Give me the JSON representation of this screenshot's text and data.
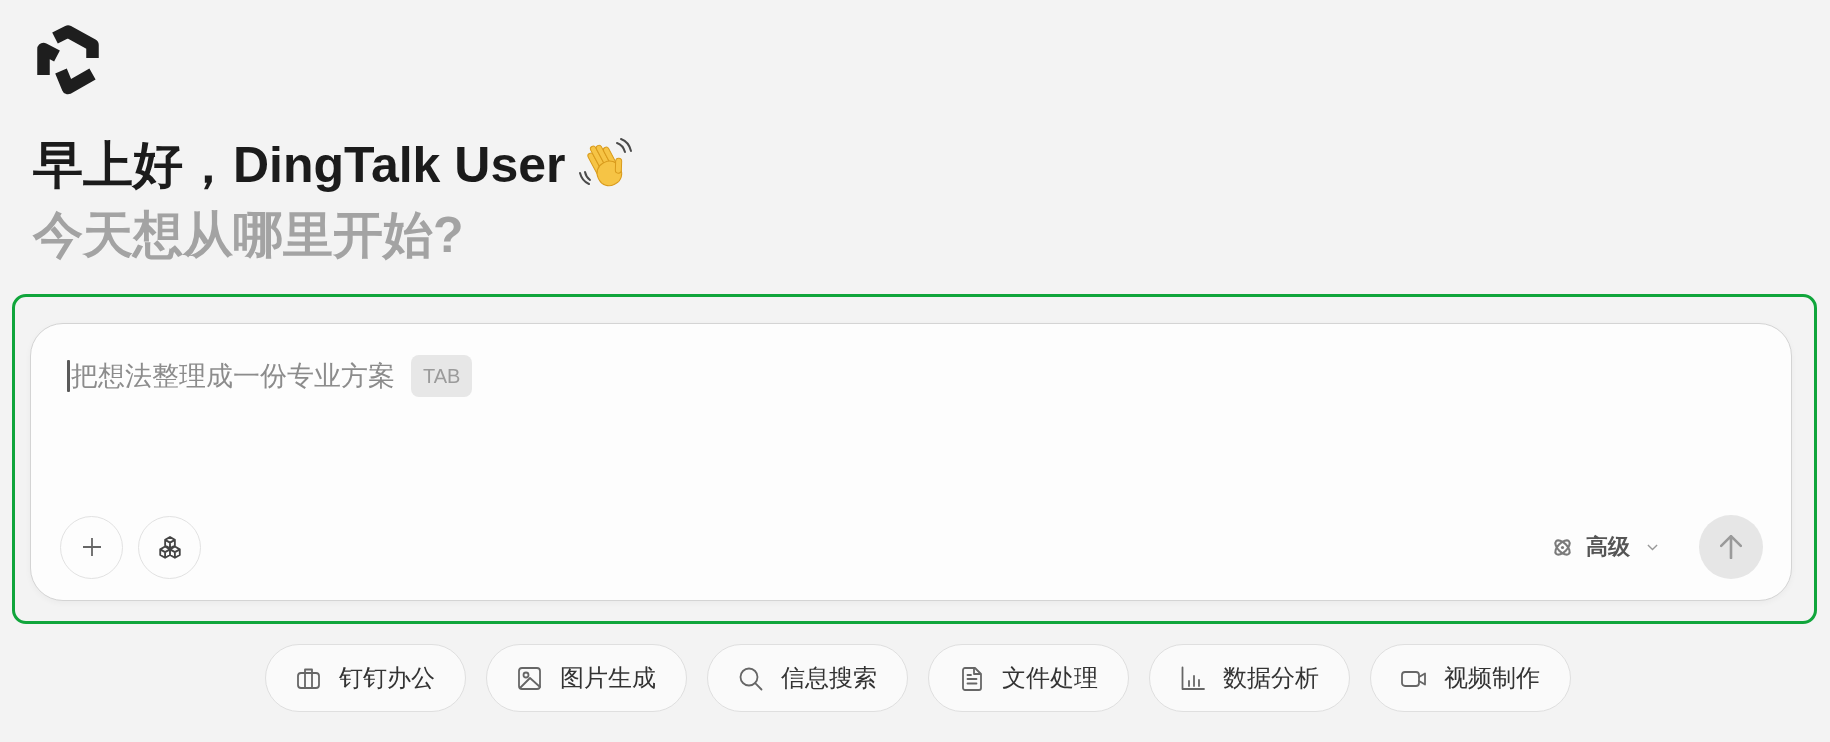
{
  "greeting": {
    "title": "早上好，DingTalk User",
    "subtitle": "今天想从哪里开始?"
  },
  "composer": {
    "highlighted": true,
    "focused": true,
    "placeholder": "把想法整理成一份专业方案",
    "shortcut_key": "TAB",
    "mode": {
      "label": "高级"
    },
    "send_button": {
      "disabled": true
    }
  },
  "shortcuts": [
    {
      "label": "钉钉办公"
    },
    {
      "label": "图片生成"
    },
    {
      "label": "信息搜索"
    },
    {
      "label": "文件处理"
    },
    {
      "label": "数据分析"
    },
    {
      "label": "视频制作"
    }
  ]
}
